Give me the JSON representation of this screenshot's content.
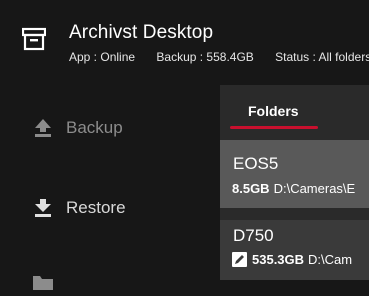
{
  "app": {
    "title": "Archivst Desktop",
    "status": {
      "app": "App : Online",
      "backup": "Backup : 558.4GB",
      "folders": "Status : All folders"
    }
  },
  "nav": {
    "backup_label": "Backup",
    "restore_label": "Restore"
  },
  "panel": {
    "tab_label": "Folders",
    "folders": [
      {
        "name": "EOS5",
        "size": "8.5GB",
        "path": "D:\\Cameras\\E"
      },
      {
        "name": "D750",
        "size": "535.3GB",
        "path": "D:\\Cam"
      }
    ]
  },
  "colors": {
    "background": "#171717",
    "panel": "#2a2a2a",
    "accent": "#c8102e",
    "selected_card": "#595959"
  },
  "icons": [
    "archive-icon",
    "upload-icon",
    "download-icon",
    "folder-icon",
    "sync-edit-icon"
  ]
}
